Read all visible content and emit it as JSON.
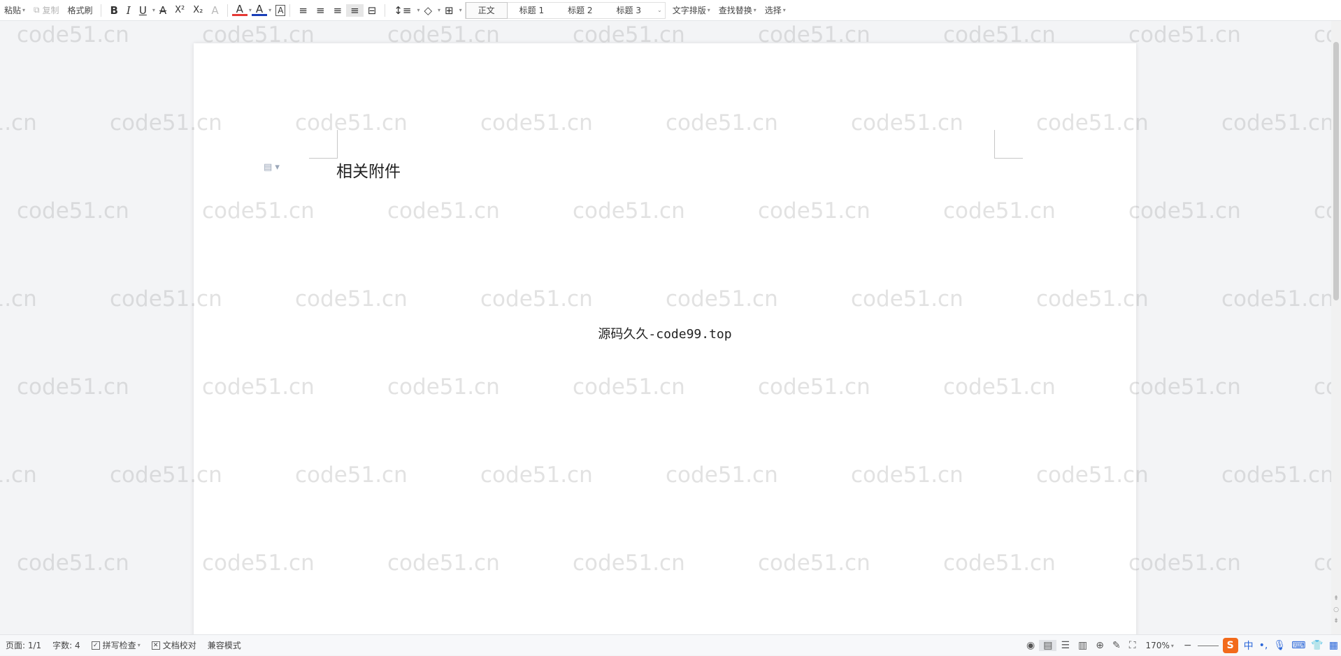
{
  "toolbar": {
    "paste": "粘贴",
    "copy": "复制",
    "format_painter": "格式刷",
    "bold": "B",
    "italic": "I",
    "underline": "U",
    "strikethrough": "A",
    "superscript": "X²",
    "subscript": "X₂",
    "clear_format": "A",
    "highlight": "A",
    "font_color": "A",
    "char_border": "A",
    "styles": [
      "正文",
      "标题 1",
      "标题 2",
      "标题 3"
    ],
    "text_layout": "文字排版",
    "find_replace": "查找替换",
    "select": "选择"
  },
  "document": {
    "heading": "相关附件",
    "center_text": "源码久久-code99.top"
  },
  "watermark": "code51.cn",
  "statusbar": {
    "page": "页面: 1/1",
    "word_count": "字数: 4",
    "spell_check": "拼写检查",
    "doc_proof": "文档校对",
    "compat_mode": "兼容模式",
    "zoom": "170%",
    "ime_lang": "中"
  },
  "colors": {
    "highlight": "#e53935",
    "font_color": "#1a3fb8",
    "sogou": "#f26a1b"
  }
}
